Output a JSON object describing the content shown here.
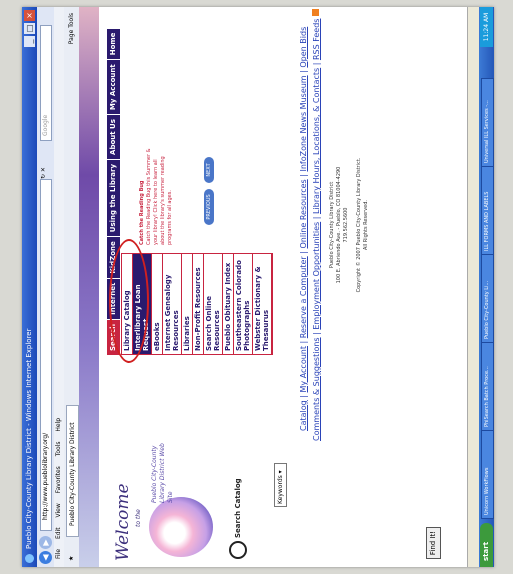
{
  "window": {
    "title": "Pueblo City-County Library District - Windows Internet Explorer"
  },
  "browser": {
    "address": "http://www.pueblolibrary.org/",
    "search_placeholder": "Google",
    "menu": [
      "File",
      "Edit",
      "View",
      "Favorites",
      "Tools",
      "Help"
    ],
    "tab_title": "Pueblo City-County Library District",
    "commands": "Page  Tools"
  },
  "site": {
    "welcome": "Welcome",
    "to_the": "to the",
    "web_site_text": "Pueblo City-County Library District Web Site",
    "search_catalog": "Search Catalog",
    "keywords_option": "Keywords",
    "find_it": "Find It!",
    "tabs": [
      "Search",
      "Internet",
      "KidZone",
      "Using the Library",
      "About Us",
      "My Account",
      "Home"
    ],
    "menu_items": [
      "Library Catalog",
      "Interlibrary Loan Request",
      "eBooks",
      "Internet Genealogy Resources",
      "Libraries",
      "Non-Profit Resources",
      "Search Online Resources",
      "Pueblo Obituary Index",
      "Southeastern Colorado Photographs",
      "Webster Dictionary & Thesaurus"
    ],
    "reading_bug": "Catch the Reading Bug",
    "reading_text": "Catch the Reading Bug this Summer & your library! Click here to learn all about the library's summer reading programs for all ages.",
    "previous": "PREVIOUS",
    "next": "NEXT",
    "footer_links_1": [
      "Catalog",
      "My Account",
      "Reserve a Computer",
      "Online Resources",
      "InfoZone News Museum",
      "Open Bids"
    ],
    "footer_links_2": [
      "Comments & Suggestions",
      "Employment Opportunities",
      "Library Hours, Locations, & Contacts",
      "RSS Feeds"
    ],
    "address_lines": [
      "Pueblo City-County Library District",
      "100 E. Abriendo Ave. - Pueblo, CO 81004-4290",
      "719.562.5600",
      "Copyright © 2007 Pueblo City-County Library District.",
      "All Rights Reserved."
    ]
  },
  "taskbar": {
    "start": "start",
    "tasks": [
      "Unicorn WorkFlows",
      "PhiSearch Batch Proce...",
      "Pueblo City-County Li...",
      "ILL FORMS AND LABELS",
      "Universal ILL Services -..."
    ],
    "clock": "11:24 AM"
  },
  "colors": {
    "accent_navy": "#2a1a6e",
    "accent_red": "#c82440",
    "annotation_red": "#d02020"
  }
}
